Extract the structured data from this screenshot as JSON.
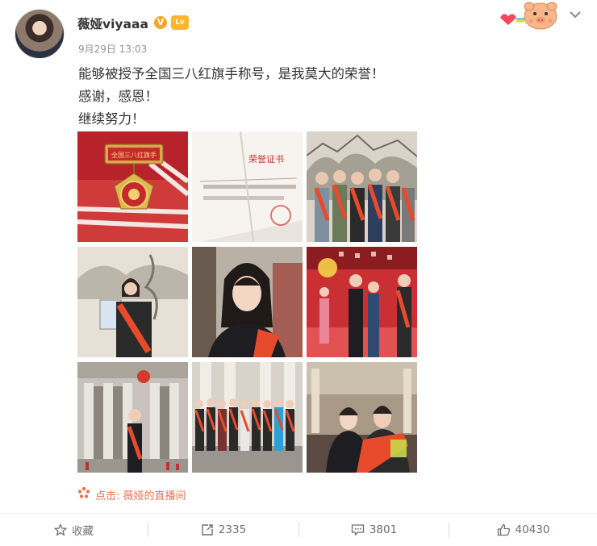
{
  "post": {
    "username": "薇娅viyaaa",
    "verified_badge": "V",
    "level_badge": "Lv",
    "timestamp": "9月29日 13:03",
    "text_lines": [
      "能够被授予全国三八红旗手称号，是我莫大的荣誉！",
      "感谢，感恩！",
      "继续努力！"
    ],
    "photos": [
      {
        "icon": "medal-photo",
        "description_label": "全国三八红旗手"
      },
      {
        "icon": "certificate-photo",
        "description_label": "荣誉证书"
      },
      {
        "icon": "group-photo"
      },
      {
        "icon": "portrait-photo"
      },
      {
        "icon": "closeup-photo"
      },
      {
        "icon": "ceremony-photo"
      },
      {
        "icon": "great-hall-photo"
      },
      {
        "icon": "group-line-photo"
      },
      {
        "icon": "hall-selfie-photo"
      }
    ],
    "link": {
      "icon": "live-icon",
      "text": "点击: 薇娅的直播间"
    }
  },
  "actions": {
    "favorite_label": "收藏",
    "repost_count": "2335",
    "comment_count": "3801",
    "like_count": "40430"
  },
  "colors": {
    "accent": "#eb7350",
    "sash": "#e84a2c",
    "text": "#333333",
    "muted": "#939393"
  }
}
